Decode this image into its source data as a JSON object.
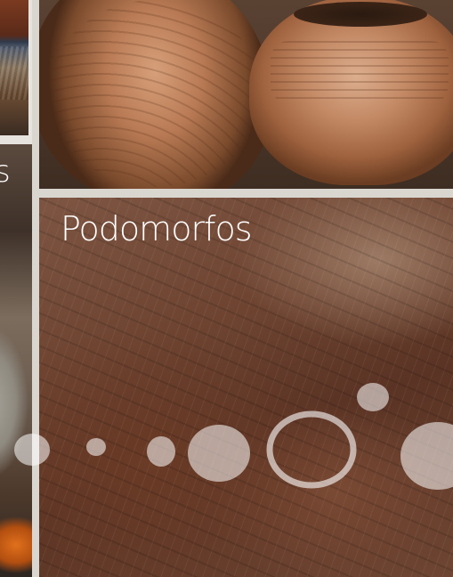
{
  "left_panel": {
    "caption_fragment": "s"
  },
  "vessels_panel": {
    "photo": "ceramic-vessels"
  },
  "rock_panel": {
    "title": "Podomorfos",
    "photo": "rock-engraving"
  },
  "colors": {
    "background": "#d9d6d0",
    "caption": "#ffffff",
    "dots": "#ffffff"
  },
  "decoration": {
    "dot_trail": "dots-and-ring"
  }
}
